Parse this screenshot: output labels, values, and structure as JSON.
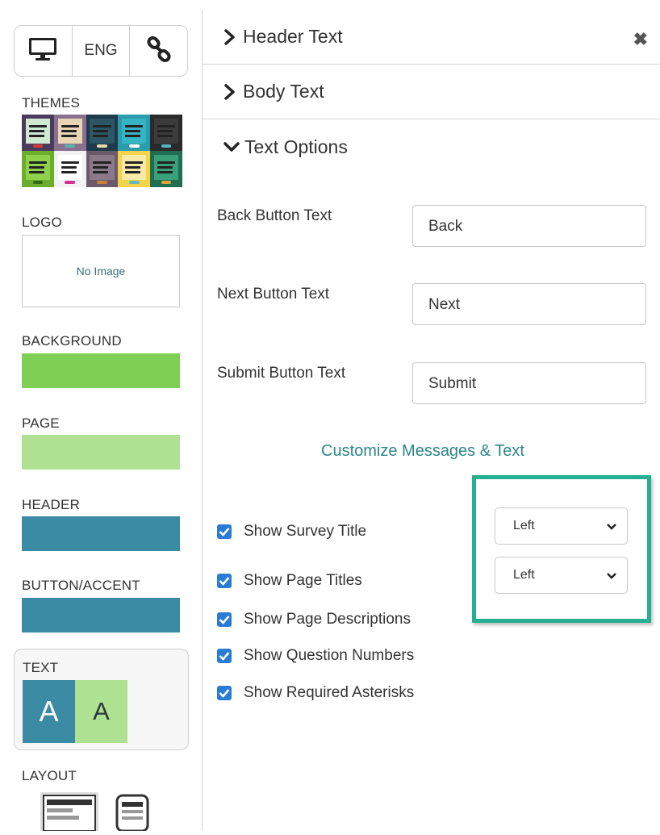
{
  "sidebar": {
    "view_toggle": {
      "eng_label": "ENG"
    },
    "themes_label": "THEMES",
    "themes": [
      {
        "bg": "#4a3a5c",
        "card": "#cfe8d2",
        "accent": "#d23a3a"
      },
      {
        "bg": "#8a6f8f",
        "card": "#e8d5b5",
        "accent": "#5fb0b0"
      },
      {
        "bg": "#1e3a4c",
        "card": "#2c5566",
        "accent": "#e5d8a5"
      },
      {
        "bg": "#2a9dad",
        "card": "#36b4c4",
        "accent": "#ffffff"
      },
      {
        "bg": "#2a2a2a",
        "card": "#3b3b3b",
        "accent": "#4fb7c7"
      },
      {
        "bg": "#6cae2b",
        "card": "#8fd14a",
        "accent": "#2d6a1a"
      },
      {
        "bg": "#f2f2f2",
        "card": "#ffffff",
        "accent": "#d82e8e"
      },
      {
        "bg": "#6b5a6a",
        "card": "#8a7a89",
        "accent": "#c8823c"
      },
      {
        "bg": "#f3d34a",
        "card": "#f7e9a8",
        "accent": "#63b8c2"
      },
      {
        "bg": "#1f6e52",
        "card": "#3aa07a",
        "accent": "#e2a23a"
      }
    ],
    "logo_label": "LOGO",
    "logo_placeholder": "No Image",
    "background_label": "BACKGROUND",
    "background_color": "#7fcf55",
    "page_label": "PAGE",
    "page_color": "#afe192",
    "header_label": "HEADER",
    "header_color": "#3a8ba3",
    "button_accent_label": "BUTTON/ACCENT",
    "button_accent_color": "#3a8ba3",
    "text_label": "TEXT",
    "text_sample_dark": "A",
    "text_sample_light": "A",
    "text_sample_dark_bg": "#3a8ba3",
    "text_sample_light_bg": "#afe192",
    "layout_label": "LAYOUT"
  },
  "panel": {
    "sections": [
      {
        "title": "Header Text",
        "expanded": false
      },
      {
        "title": "Body Text",
        "expanded": false
      },
      {
        "title": "Text Options",
        "expanded": true
      }
    ],
    "close_icon": "close-icon",
    "fields": {
      "back": {
        "label": "Back Button Text",
        "value": "Back"
      },
      "next": {
        "label": "Next Button Text",
        "value": "Next"
      },
      "submit": {
        "label": "Submit Button Text",
        "value": "Submit"
      }
    },
    "customize_link": "Customize Messages & Text",
    "checkboxes": [
      {
        "label": "Show Survey Title",
        "checked": true
      },
      {
        "label": "Show Page Titles",
        "checked": true
      },
      {
        "label": "Show Page Descriptions",
        "checked": true
      },
      {
        "label": "Show Question Numbers",
        "checked": true
      },
      {
        "label": "Show Required Asterisks",
        "checked": true
      }
    ],
    "alignment_selects": [
      {
        "value": "Left"
      },
      {
        "value": "Left"
      }
    ],
    "highlight_color": "#24b08f",
    "checkbox_color": "#2a7bd4",
    "link_color": "#2e8589"
  }
}
